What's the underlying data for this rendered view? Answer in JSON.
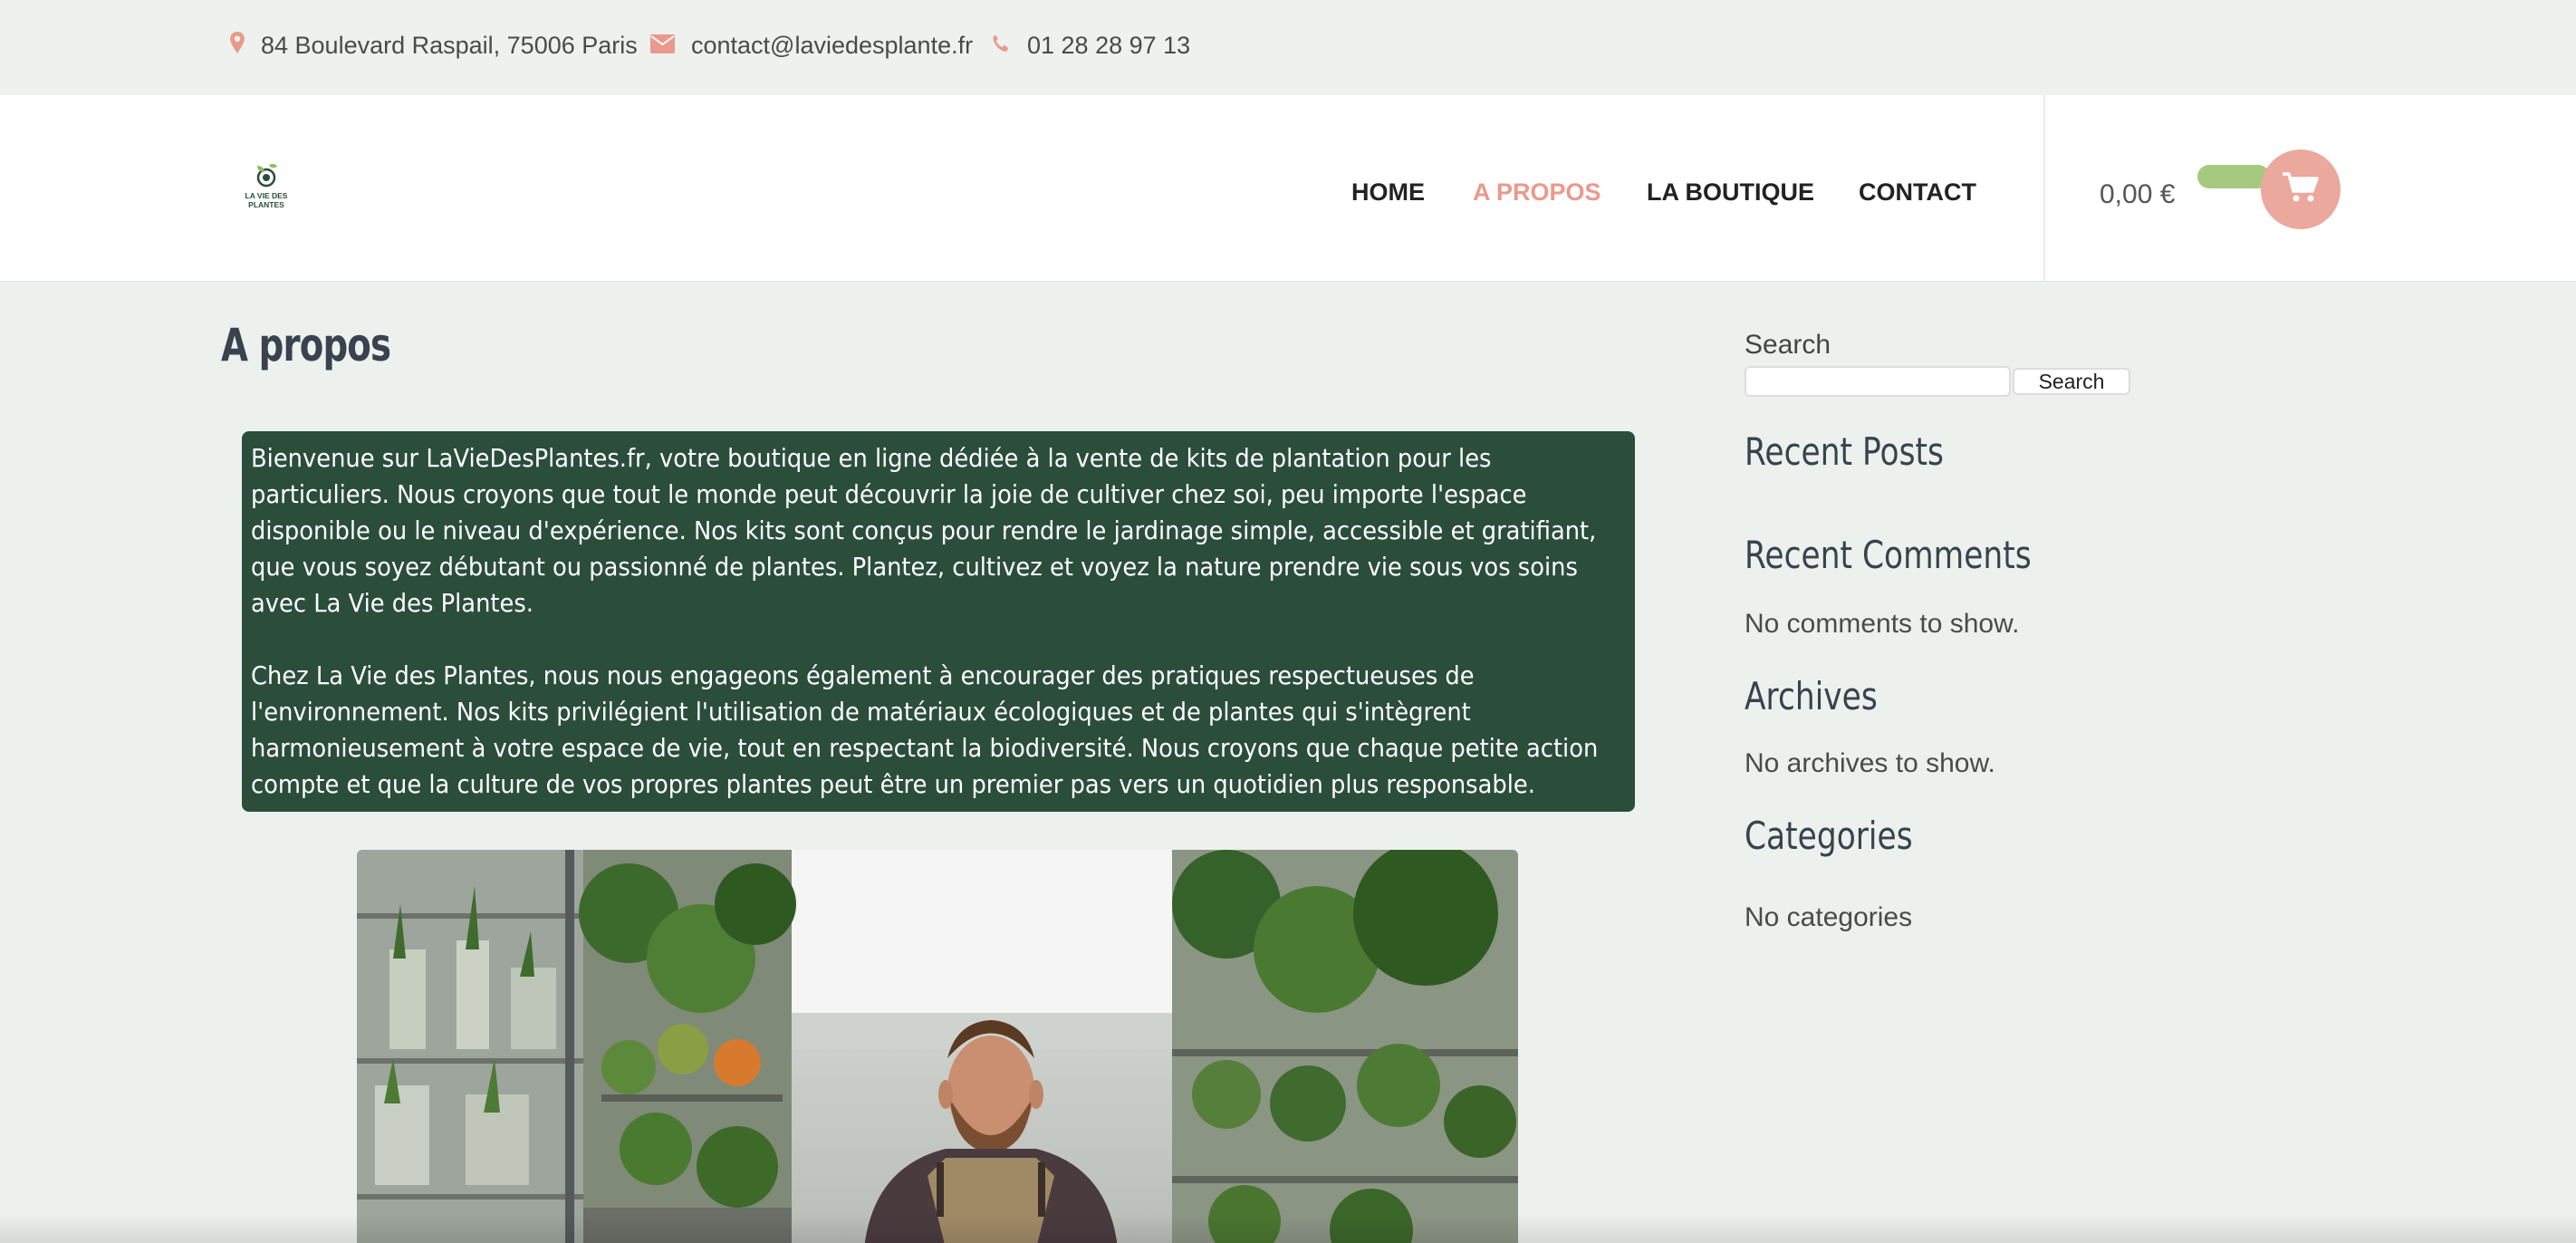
{
  "topbar": {
    "address": "84 Boulevard Raspail, 75006 Paris",
    "email": "contact@laviedesplante.fr",
    "phone": "01 28 28 97 13",
    "icon_color": "#e99a8c"
  },
  "header": {
    "logo": {
      "line1": "LA VIE DES",
      "line2": "PLANTES"
    },
    "nav": [
      {
        "label": "HOME",
        "active": false
      },
      {
        "label": "A PROPOS",
        "active": true
      },
      {
        "label": "LA BOUTIQUE",
        "active": false
      },
      {
        "label": "CONTACT",
        "active": false
      }
    ],
    "cart_total": "0,00 €",
    "cart_icon": "cart-icon",
    "accent_color": "#e99a8c"
  },
  "main": {
    "title": "A propos",
    "about": {
      "paragraph1": "Bienvenue sur LaVieDesPlantes.fr, votre boutique en ligne dédiée à la vente de kits de plantation pour les particuliers. Nous croyons que tout le monde peut découvrir la joie de cultiver chez soi, peu importe l'espace disponible ou le niveau d'expérience. Nos kits sont conçus pour rendre le jardinage simple, accessible et gratifiant, que vous soyez débutant ou passionné de plantes. Plantez, cultivez et voyez la nature prendre vie sous vos soins avec La Vie des Plantes.",
      "paragraph2": "Chez La Vie des Plantes, nous nous engageons également à encourager des pratiques respectueuses de l'environnement. Nos kits privilégient l'utilisation de matériaux écologiques et de plantes qui s'intègrent harmonieusement à votre espace de vie, tout en respectant la biodiversité. Nous croyons que chaque petite action compte et que la culture de vos propres plantes peut être un premier pas vers un quotidien plus responsable.",
      "background": "#2a4d3c"
    }
  },
  "sidebar": {
    "search_label": "Search",
    "search_value": "",
    "search_button": "Search",
    "recent_posts_title": "Recent Posts",
    "recent_comments_title": "Recent Comments",
    "recent_comments_text": "No comments to show.",
    "archives_title": "Archives",
    "archives_text": "No archives to show.",
    "categories_title": "Categories",
    "categories_text": "No categories"
  }
}
